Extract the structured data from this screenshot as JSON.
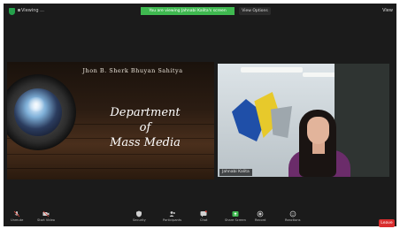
{
  "window": {
    "label": "Viewing ...",
    "recording_banner": "You are viewing Jahnabi Kalita's screen",
    "view_options": "View Options",
    "view_button": "View"
  },
  "slide": {
    "header": "Jhon B. Sherk Bhuyan Sahitya",
    "title_line1": "Department",
    "title_line2": "of",
    "title_line3": "Mass Media"
  },
  "video": {
    "participant_name": "Jahnabi Kalita"
  },
  "toolbar": {
    "mute": "Unmute",
    "video": "Start Video",
    "security": "Security",
    "participants": "Participants",
    "participants_count": "4",
    "chat": "Chat",
    "share": "Share Screen",
    "record": "Record",
    "reactions": "Reactions",
    "end": "Leave"
  },
  "colors": {
    "accent_green": "#3fb950",
    "leave_red": "#d92d2d"
  }
}
